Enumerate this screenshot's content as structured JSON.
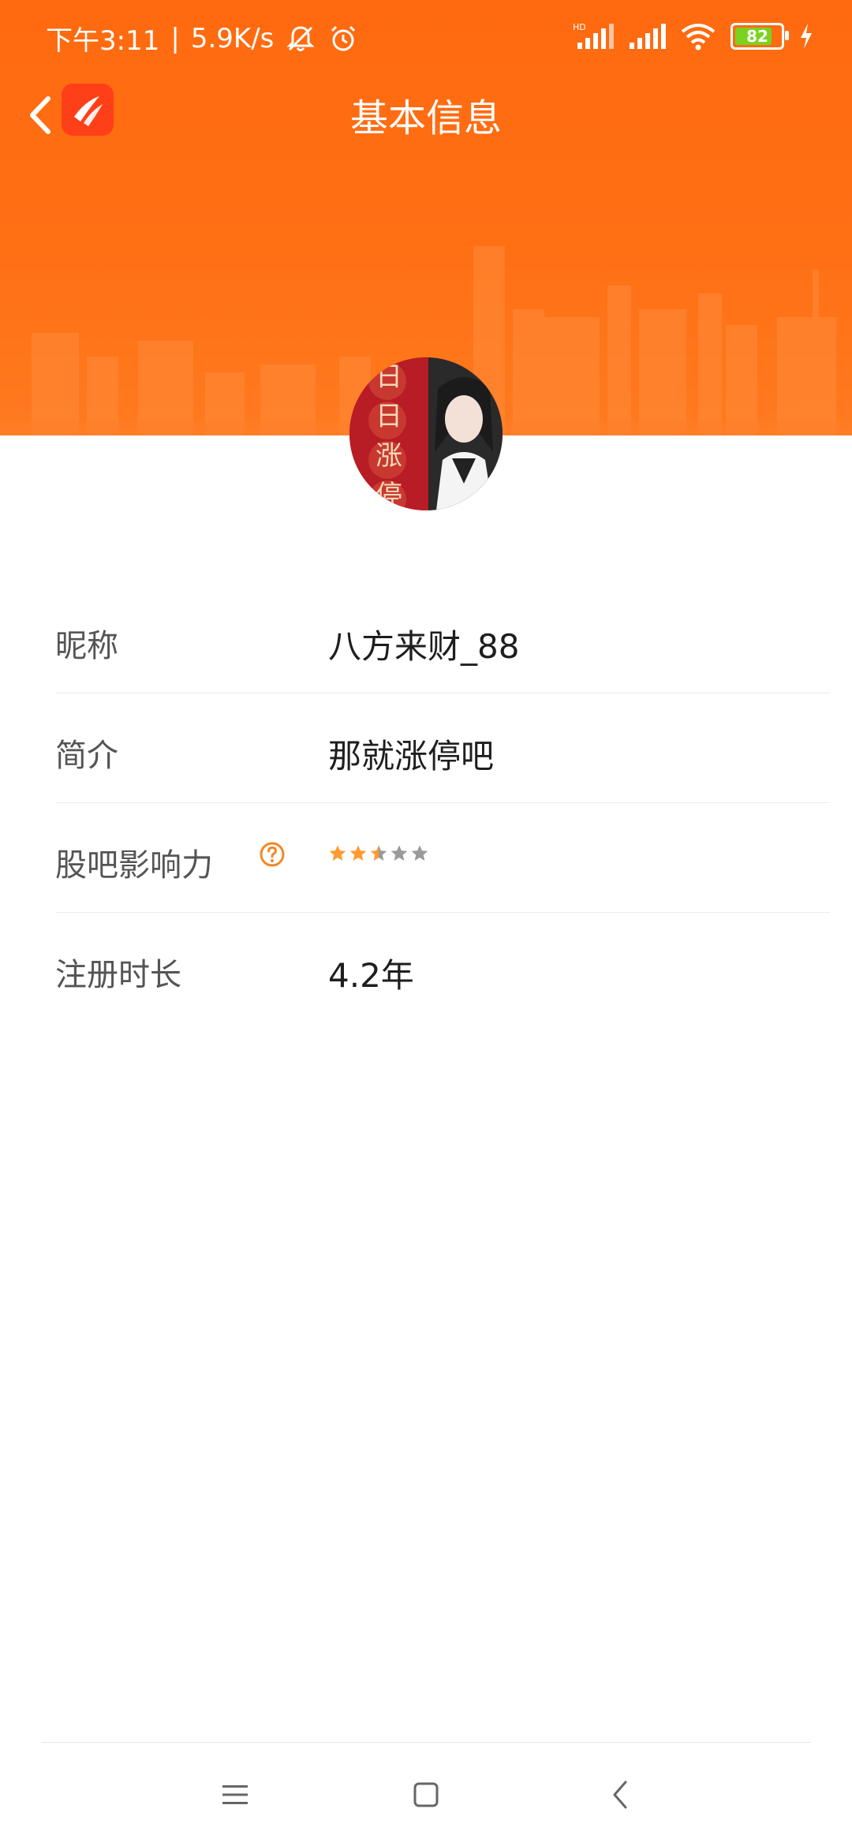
{
  "status_bar": {
    "time": "下午3:11",
    "separator": "|",
    "net_speed": "5.9K/s",
    "battery_level": 82,
    "battery_text": "82"
  },
  "header": {
    "title": "基本信息"
  },
  "profile": {
    "avatar_text": [
      "日",
      "日",
      "涨",
      "停"
    ],
    "rows": [
      {
        "label": "昵称",
        "value": "八方来财_88"
      },
      {
        "label": "简介",
        "value": "那就涨停吧"
      },
      {
        "label": "股吧影响力",
        "rating": 2.5,
        "max": 5
      },
      {
        "label": "注册时长",
        "value": "4.2年"
      }
    ]
  },
  "colors": {
    "header_orange": "#ff6a10",
    "star_active": "#ff9a2e",
    "star_inactive": "#9a9a9a",
    "help_icon": "#f08a24"
  },
  "icons": {
    "back": "chevron-left-icon",
    "logo": "app-logo-icon",
    "help": "question-circle-icon",
    "menu": "menu-icon",
    "home": "home-square-icon",
    "system_back": "system-back-icon"
  }
}
